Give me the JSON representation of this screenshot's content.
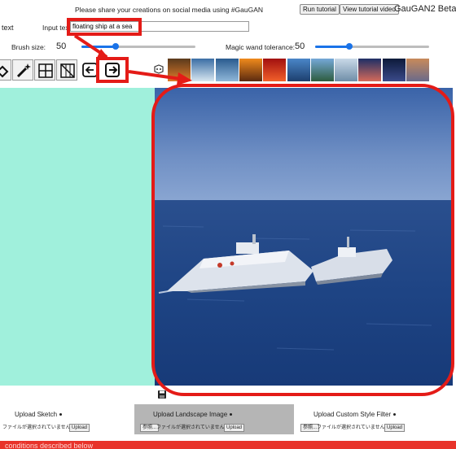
{
  "header": {
    "notice": "Please share your creations on social media using #GauGAN",
    "run_tutorial": "Run tutorial",
    "view_tutorial_video": "View tutorial video",
    "app_title": "GauGAN2 Beta"
  },
  "text_row": {
    "mode_label": "text",
    "input_label": "Input text:",
    "input_value": "floating ship at a sea"
  },
  "sliders": {
    "brush_label": "Brush size:",
    "brush_value": "50",
    "brush_fraction": 0.3,
    "wand_label": "Magic wand tolerance:",
    "wand_value": "50",
    "wand_fraction": 0.3
  },
  "style_thumbnails": [
    {
      "name": "sunset-field",
      "c1": "#5a3a1c",
      "c2": "#e07b2a"
    },
    {
      "name": "lake-mountain",
      "c1": "#3b6ea5",
      "c2": "#d7e6f0"
    },
    {
      "name": "coast-blue",
      "c1": "#2a5b8f",
      "c2": "#8fb7d9"
    },
    {
      "name": "orange-sunset",
      "c1": "#f08a1c",
      "c2": "#5b2a10"
    },
    {
      "name": "red-dusk",
      "c1": "#a21010",
      "c2": "#f2602a"
    },
    {
      "name": "sea-horizon",
      "c1": "#4a86c8",
      "c2": "#1d3f6e"
    },
    {
      "name": "island-bay",
      "c1": "#75a8d8",
      "c2": "#2d5c3e"
    },
    {
      "name": "snow-field",
      "c1": "#c9d9e8",
      "c2": "#6f8ea8"
    },
    {
      "name": "purple-dusk",
      "c1": "#1e2f66",
      "c2": "#d56a5a"
    },
    {
      "name": "night-sky",
      "c1": "#0d1a3a",
      "c2": "#3a4a8a"
    },
    {
      "name": "warm-haze",
      "c1": "#c88a5a",
      "c2": "#6a6a8a"
    }
  ],
  "uploads": {
    "sketch_label": "Upload Sketch",
    "landscape_label": "Upload Landscape Image",
    "style_label": "Upload Custom Style Filter",
    "browse": "参照...",
    "no_file": "ファイルが選択されていません。",
    "upload_button": "Upload"
  },
  "footer": {
    "text": "conditions described below"
  },
  "colors": {
    "canvas_bg": "#a0f0dc",
    "highlight_red": "#e41b17",
    "footer_red": "#e8332a",
    "landscape_panel": "#b5b5b5"
  }
}
